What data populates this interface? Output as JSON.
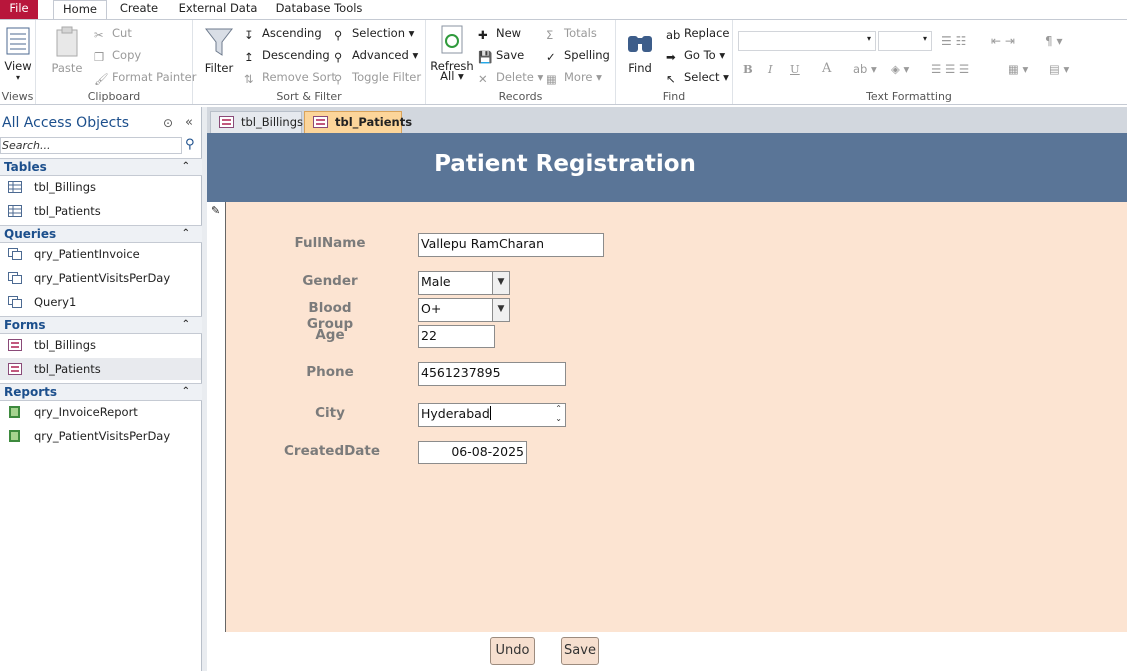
{
  "ribbon_tabs": [
    "File",
    "Home",
    "Create",
    "External Data",
    "Database Tools"
  ],
  "ribbon": {
    "views": {
      "view_label": "View",
      "group": "Views"
    },
    "clipboard": {
      "paste": "Paste",
      "cut": "Cut",
      "copy": "Copy",
      "format_painter": "Format Painter",
      "group": "Clipboard"
    },
    "sort_filter": {
      "filter": "Filter",
      "ascending": "Ascending",
      "descending": "Descending",
      "remove_sort": "Remove Sort",
      "selection": "Selection",
      "advanced": "Advanced",
      "toggle_filter": "Toggle Filter",
      "group": "Sort & Filter"
    },
    "records": {
      "refresh_line1": "Refresh",
      "refresh_line2": "All",
      "new": "New",
      "save": "Save",
      "delete": "Delete",
      "totals": "Totals",
      "spelling": "Spelling",
      "more": "More",
      "group": "Records"
    },
    "find": {
      "find": "Find",
      "replace": "Replace",
      "goto": "Go To",
      "select": "Select",
      "group": "Find"
    },
    "text_formatting": {
      "group": "Text Formatting",
      "bold": "B",
      "italic": "I",
      "underline": "U",
      "font_color": "A"
    }
  },
  "nav": {
    "title": "All Access Objects",
    "search_placeholder": "Search...",
    "sections": [
      {
        "label": "Tables",
        "items": [
          "tbl_Billings",
          "tbl_Patients"
        ]
      },
      {
        "label": "Queries",
        "items": [
          "qry_PatientInvoice",
          "qry_PatientVisitsPerDay",
          "Query1"
        ]
      },
      {
        "label": "Forms",
        "items": [
          "tbl_Billings",
          "tbl_Patients"
        ]
      },
      {
        "label": "Reports",
        "items": [
          "qry_InvoiceReport",
          "qry_PatientVisitsPerDay"
        ]
      }
    ]
  },
  "doc_tabs": [
    "tbl_Billings",
    "tbl_Patients"
  ],
  "form": {
    "title": "Patient Registration",
    "fields": {
      "fullname": {
        "label": "FullName",
        "value": "Vallepu RamCharan"
      },
      "gender": {
        "label": "Gender",
        "value": "Male"
      },
      "blood_group": {
        "label": "Blood Group",
        "value": "O+"
      },
      "age": {
        "label": "Age",
        "value": "22"
      },
      "phone": {
        "label": "Phone",
        "value": "4561237895"
      },
      "city": {
        "label": "City",
        "value": "Hyderabad"
      },
      "created_date": {
        "label": "CreatedDate",
        "value": "06-08-2025"
      }
    },
    "buttons": {
      "undo": "Undo",
      "save": "Save"
    }
  },
  "colors": {
    "file_tab": "#b8163b",
    "form_header": "#5a7597",
    "form_body": "#fce4d2",
    "active_doc_tab": "#fcd59a",
    "nav_text": "#1c4f8c"
  }
}
